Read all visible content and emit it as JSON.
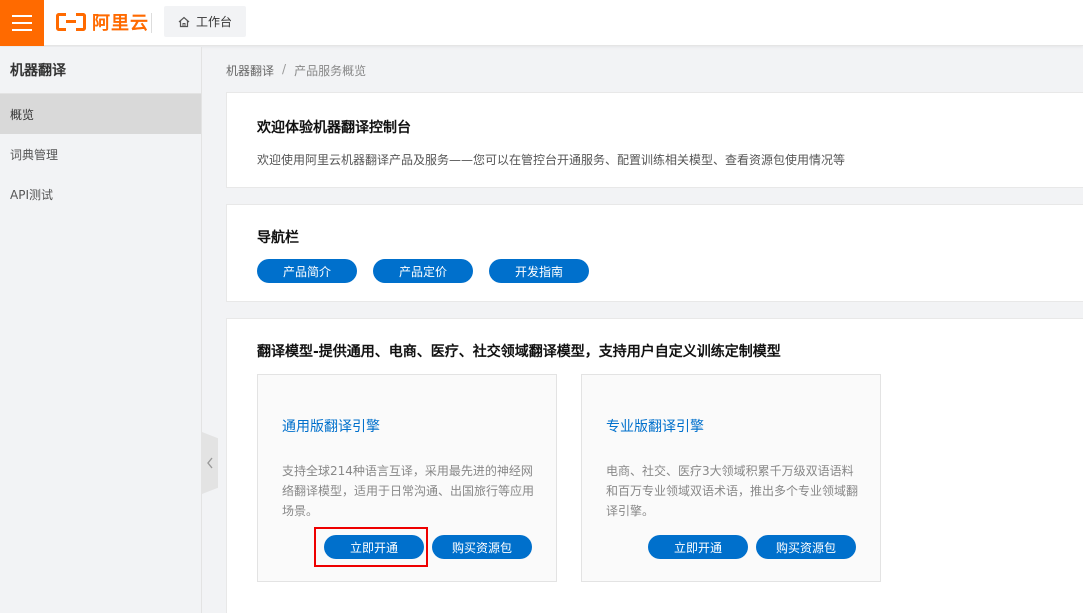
{
  "topbar": {
    "logo_text": "阿里云",
    "workbench_label": "工作台",
    "brand_color": "#ff6a00"
  },
  "sidebar": {
    "title": "机器翻译",
    "items": [
      {
        "label": "概览",
        "active": true
      },
      {
        "label": "词典管理",
        "active": false
      },
      {
        "label": "API测试",
        "active": false
      }
    ]
  },
  "breadcrumb": {
    "items": [
      "机器翻译",
      "产品服务概览"
    ],
    "separator": "/"
  },
  "welcome": {
    "title": "欢迎体验机器翻译控制台",
    "description": "欢迎使用阿里云机器翻译产品及服务——您可以在管控台开通服务、配置训练相关模型、查看资源包使用情况等"
  },
  "nav": {
    "title": "导航栏",
    "buttons": [
      "产品简介",
      "产品定价",
      "开发指南"
    ]
  },
  "models": {
    "title": "翻译模型-提供通用、电商、医疗、社交领域翻译模型，支持用户自定义训练定制模型",
    "engines": [
      {
        "title": "通用版翻译引擎",
        "description": "支持全球214种语言互译，采用最先进的神经网络翻译模型，适用于日常沟通、出国旅行等应用场景。",
        "activate_label": "立即开通",
        "buy_label": "购买资源包"
      },
      {
        "title": "专业版翻译引擎",
        "description": "电商、社交、医疗3大领域积累千万级双语语料和百万专业领域双语术语，推出多个专业领域翻译引擎。",
        "activate_label": "立即开通",
        "buy_label": "购买资源包"
      }
    ]
  },
  "accent_color": "#0070cc",
  "highlight_color": "#ee0000"
}
